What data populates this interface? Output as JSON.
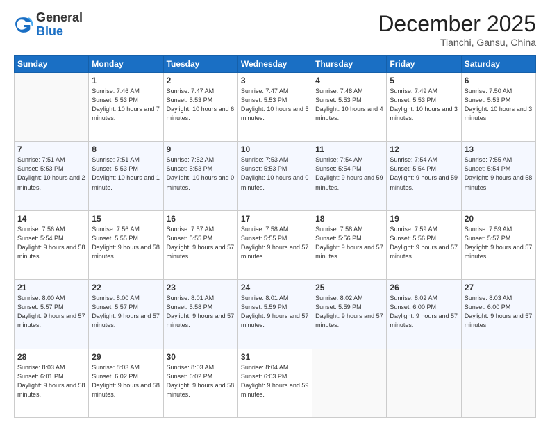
{
  "header": {
    "logo_general": "General",
    "logo_blue": "Blue",
    "month_title": "December 2025",
    "location": "Tianchi, Gansu, China"
  },
  "days_of_week": [
    "Sunday",
    "Monday",
    "Tuesday",
    "Wednesday",
    "Thursday",
    "Friday",
    "Saturday"
  ],
  "weeks": [
    [
      {
        "day": "",
        "sunrise": "",
        "sunset": "",
        "daylight": ""
      },
      {
        "day": "1",
        "sunrise": "Sunrise: 7:46 AM",
        "sunset": "Sunset: 5:53 PM",
        "daylight": "Daylight: 10 hours and 7 minutes."
      },
      {
        "day": "2",
        "sunrise": "Sunrise: 7:47 AM",
        "sunset": "Sunset: 5:53 PM",
        "daylight": "Daylight: 10 hours and 6 minutes."
      },
      {
        "day": "3",
        "sunrise": "Sunrise: 7:47 AM",
        "sunset": "Sunset: 5:53 PM",
        "daylight": "Daylight: 10 hours and 5 minutes."
      },
      {
        "day": "4",
        "sunrise": "Sunrise: 7:48 AM",
        "sunset": "Sunset: 5:53 PM",
        "daylight": "Daylight: 10 hours and 4 minutes."
      },
      {
        "day": "5",
        "sunrise": "Sunrise: 7:49 AM",
        "sunset": "Sunset: 5:53 PM",
        "daylight": "Daylight: 10 hours and 3 minutes."
      },
      {
        "day": "6",
        "sunrise": "Sunrise: 7:50 AM",
        "sunset": "Sunset: 5:53 PM",
        "daylight": "Daylight: 10 hours and 3 minutes."
      }
    ],
    [
      {
        "day": "7",
        "sunrise": "Sunrise: 7:51 AM",
        "sunset": "Sunset: 5:53 PM",
        "daylight": "Daylight: 10 hours and 2 minutes."
      },
      {
        "day": "8",
        "sunrise": "Sunrise: 7:51 AM",
        "sunset": "Sunset: 5:53 PM",
        "daylight": "Daylight: 10 hours and 1 minute."
      },
      {
        "day": "9",
        "sunrise": "Sunrise: 7:52 AM",
        "sunset": "Sunset: 5:53 PM",
        "daylight": "Daylight: 10 hours and 0 minutes."
      },
      {
        "day": "10",
        "sunrise": "Sunrise: 7:53 AM",
        "sunset": "Sunset: 5:53 PM",
        "daylight": "Daylight: 10 hours and 0 minutes."
      },
      {
        "day": "11",
        "sunrise": "Sunrise: 7:54 AM",
        "sunset": "Sunset: 5:54 PM",
        "daylight": "Daylight: 9 hours and 59 minutes."
      },
      {
        "day": "12",
        "sunrise": "Sunrise: 7:54 AM",
        "sunset": "Sunset: 5:54 PM",
        "daylight": "Daylight: 9 hours and 59 minutes."
      },
      {
        "day": "13",
        "sunrise": "Sunrise: 7:55 AM",
        "sunset": "Sunset: 5:54 PM",
        "daylight": "Daylight: 9 hours and 58 minutes."
      }
    ],
    [
      {
        "day": "14",
        "sunrise": "Sunrise: 7:56 AM",
        "sunset": "Sunset: 5:54 PM",
        "daylight": "Daylight: 9 hours and 58 minutes."
      },
      {
        "day": "15",
        "sunrise": "Sunrise: 7:56 AM",
        "sunset": "Sunset: 5:55 PM",
        "daylight": "Daylight: 9 hours and 58 minutes."
      },
      {
        "day": "16",
        "sunrise": "Sunrise: 7:57 AM",
        "sunset": "Sunset: 5:55 PM",
        "daylight": "Daylight: 9 hours and 57 minutes."
      },
      {
        "day": "17",
        "sunrise": "Sunrise: 7:58 AM",
        "sunset": "Sunset: 5:55 PM",
        "daylight": "Daylight: 9 hours and 57 minutes."
      },
      {
        "day": "18",
        "sunrise": "Sunrise: 7:58 AM",
        "sunset": "Sunset: 5:56 PM",
        "daylight": "Daylight: 9 hours and 57 minutes."
      },
      {
        "day": "19",
        "sunrise": "Sunrise: 7:59 AM",
        "sunset": "Sunset: 5:56 PM",
        "daylight": "Daylight: 9 hours and 57 minutes."
      },
      {
        "day": "20",
        "sunrise": "Sunrise: 7:59 AM",
        "sunset": "Sunset: 5:57 PM",
        "daylight": "Daylight: 9 hours and 57 minutes."
      }
    ],
    [
      {
        "day": "21",
        "sunrise": "Sunrise: 8:00 AM",
        "sunset": "Sunset: 5:57 PM",
        "daylight": "Daylight: 9 hours and 57 minutes."
      },
      {
        "day": "22",
        "sunrise": "Sunrise: 8:00 AM",
        "sunset": "Sunset: 5:57 PM",
        "daylight": "Daylight: 9 hours and 57 minutes."
      },
      {
        "day": "23",
        "sunrise": "Sunrise: 8:01 AM",
        "sunset": "Sunset: 5:58 PM",
        "daylight": "Daylight: 9 hours and 57 minutes."
      },
      {
        "day": "24",
        "sunrise": "Sunrise: 8:01 AM",
        "sunset": "Sunset: 5:59 PM",
        "daylight": "Daylight: 9 hours and 57 minutes."
      },
      {
        "day": "25",
        "sunrise": "Sunrise: 8:02 AM",
        "sunset": "Sunset: 5:59 PM",
        "daylight": "Daylight: 9 hours and 57 minutes."
      },
      {
        "day": "26",
        "sunrise": "Sunrise: 8:02 AM",
        "sunset": "Sunset: 6:00 PM",
        "daylight": "Daylight: 9 hours and 57 minutes."
      },
      {
        "day": "27",
        "sunrise": "Sunrise: 8:03 AM",
        "sunset": "Sunset: 6:00 PM",
        "daylight": "Daylight: 9 hours and 57 minutes."
      }
    ],
    [
      {
        "day": "28",
        "sunrise": "Sunrise: 8:03 AM",
        "sunset": "Sunset: 6:01 PM",
        "daylight": "Daylight: 9 hours and 58 minutes."
      },
      {
        "day": "29",
        "sunrise": "Sunrise: 8:03 AM",
        "sunset": "Sunset: 6:02 PM",
        "daylight": "Daylight: 9 hours and 58 minutes."
      },
      {
        "day": "30",
        "sunrise": "Sunrise: 8:03 AM",
        "sunset": "Sunset: 6:02 PM",
        "daylight": "Daylight: 9 hours and 58 minutes."
      },
      {
        "day": "31",
        "sunrise": "Sunrise: 8:04 AM",
        "sunset": "Sunset: 6:03 PM",
        "daylight": "Daylight: 9 hours and 59 minutes."
      },
      {
        "day": "",
        "sunrise": "",
        "sunset": "",
        "daylight": ""
      },
      {
        "day": "",
        "sunrise": "",
        "sunset": "",
        "daylight": ""
      },
      {
        "day": "",
        "sunrise": "",
        "sunset": "",
        "daylight": ""
      }
    ]
  ]
}
